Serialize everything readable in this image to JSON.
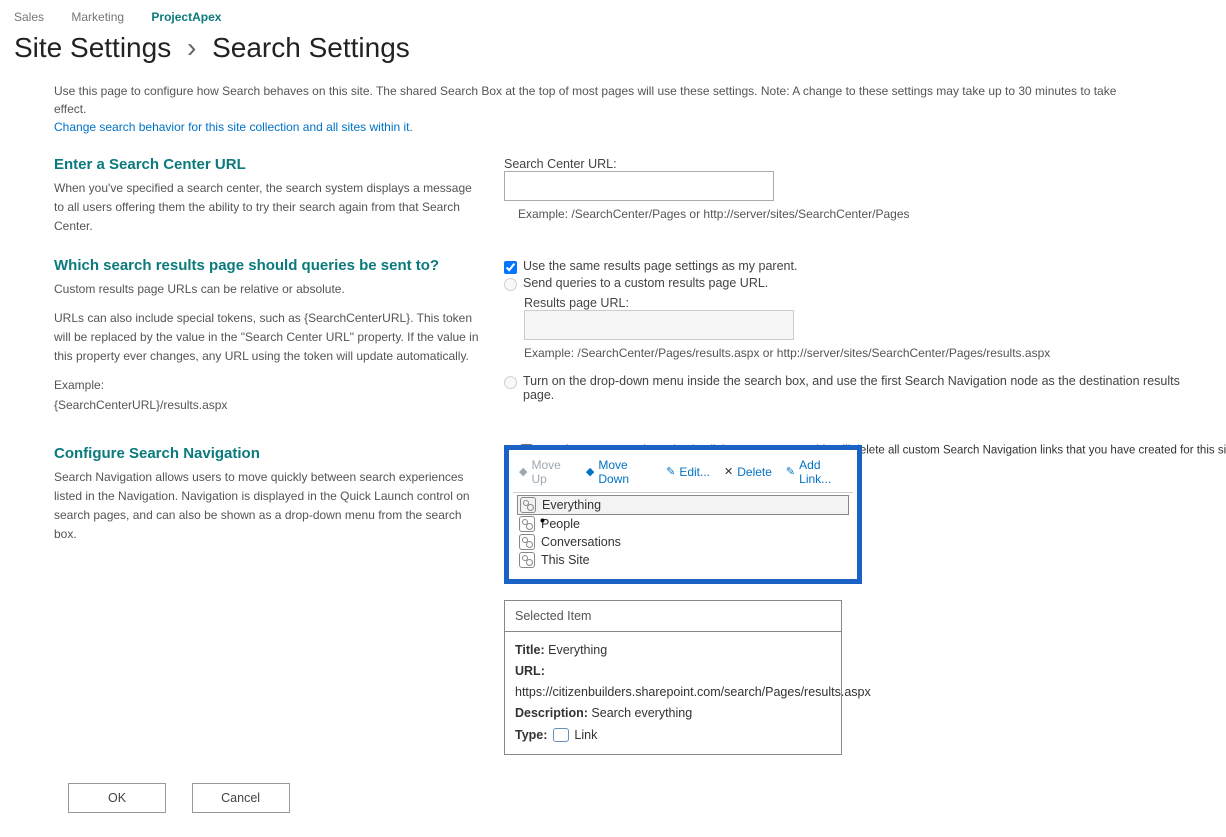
{
  "breadcrumbs": {
    "items": [
      "Sales",
      "Marketing",
      "ProjectApex"
    ],
    "activeIndex": 2
  },
  "title": {
    "part1": "Site Settings",
    "part2": "Search Settings"
  },
  "intro": {
    "text": "Use this page to configure how Search behaves on this site. The shared Search Box at the top of most pages will use these settings. Note: A change to these settings may take up to 30 minutes to take effect.",
    "link": "Change search behavior for this site collection and all sites within it."
  },
  "section_searchCenter": {
    "heading": "Enter a Search Center URL",
    "desc": "When you've specified a search center, the search system displays a message to all users offering them the ability to try their search again from that Search Center.",
    "fieldLabel": "Search Center URL:",
    "fieldValue": "",
    "example": "Example: /SearchCenter/Pages or http://server/sites/SearchCenter/Pages"
  },
  "section_resultsPage": {
    "heading": "Which search results page should queries be sent to?",
    "desc1": "Custom results page URLs can be relative or absolute.",
    "desc2": "URLs can also include special tokens, such as {SearchCenterURL}. This token will be replaced by the value in the \"Search Center URL\" property. If the value in this property ever changes, any URL using the token will update automatically.",
    "desc3a": "Example:",
    "desc3b": "{SearchCenterURL}/results.aspx",
    "opt1": "Use the same results page settings as my parent.",
    "opt2": "Send queries to a custom results page URL.",
    "resultsLabel": "Results page URL:",
    "resultsValue": "",
    "resultsExample": "Example: /SearchCenter/Pages/results.aspx or http://server/sites/SearchCenter/Pages/results.aspx",
    "opt3": "Turn on the drop-down menu inside the search box, and use the first Search Navigation node as the destination results page."
  },
  "section_nav": {
    "heading": "Configure Search Navigation",
    "desc": "Search Navigation allows users to move quickly between search experiences listed in the Navigation. Navigation is displayed in the Quick Launch control on search pages, and can also be shown as a drop-down menu from the search box.",
    "inherit": "Use the same Search Navigation links as my parent. This will delete all custom Search Navigation links that you have created for this site.",
    "toolbar": {
      "moveUp": "Move Up",
      "moveDown": "Move Down",
      "edit": "Edit...",
      "delete": "Delete",
      "addLink": "Add Link..."
    },
    "items": [
      "Everything",
      "People",
      "Conversations",
      "This Site"
    ],
    "selectedIndex": 0
  },
  "selected": {
    "panelTitle": "Selected Item",
    "titleLabel": "Title:",
    "titleValue": "Everything",
    "urlLabel": "URL:",
    "urlValue": "https://citizenbuilders.sharepoint.com/search/Pages/results.aspx",
    "descLabel": "Description:",
    "descValue": "Search everything",
    "typeLabel": "Type:",
    "typeValue": "Link"
  },
  "buttons": {
    "ok": "OK",
    "cancel": "Cancel"
  }
}
